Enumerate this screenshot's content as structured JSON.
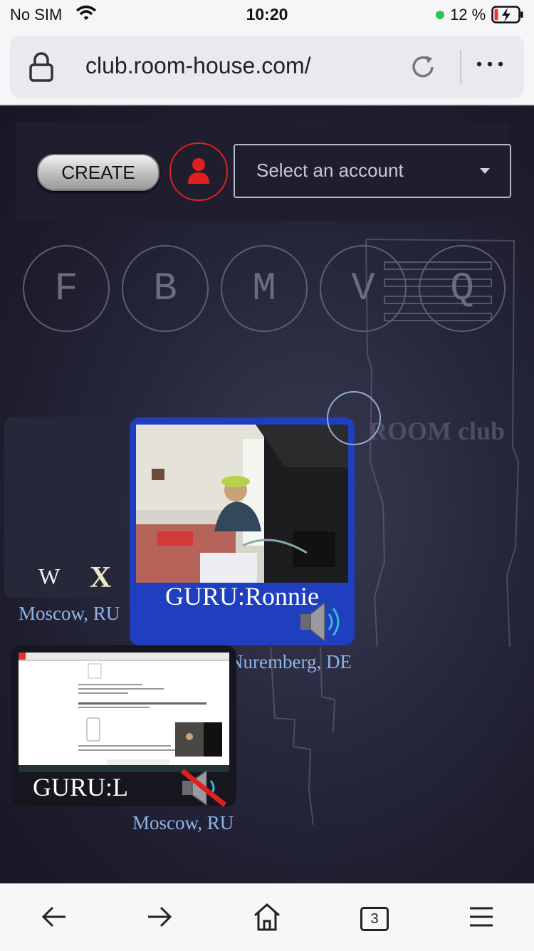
{
  "status_bar": {
    "carrier": "No SIM",
    "time": "10:20",
    "battery_percent": "12 %",
    "charging_dot_color": "#2ac54b"
  },
  "browser": {
    "url": "club.room-house.com/",
    "open_tabs": "3",
    "icons": [
      "lock-icon",
      "reload-icon",
      "more-icon",
      "back-icon",
      "forward-icon",
      "home-icon",
      "tabs-icon",
      "menu-icon"
    ]
  },
  "header": {
    "create_label": "CREATE",
    "account_placeholder": "Select an account",
    "user_icon_color": "#e02020"
  },
  "letter_buttons": [
    "F",
    "B",
    "M",
    "V",
    "Q"
  ],
  "room_brand": "ROOM club",
  "tiles": [
    {
      "id": "w",
      "label": "W",
      "close_label": "X",
      "location": "Moscow, RU"
    },
    {
      "id": "ronnie",
      "name": "GURU:Ronnie",
      "location": "Nuremberg, DE",
      "audio": "speaker-on",
      "accent": "#1f3fbf"
    },
    {
      "id": "l",
      "name": "GURU:L",
      "location": "Moscow, RU",
      "audio": "speaker-muted"
    }
  ]
}
